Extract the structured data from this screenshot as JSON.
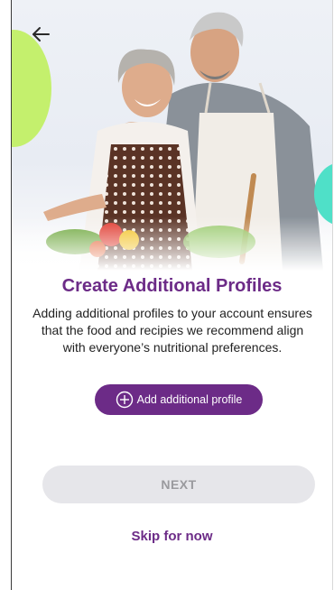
{
  "header": {
    "back_icon": "arrow-left-icon"
  },
  "hero": {
    "image_description": "",
    "accent_green": "#c4f06d",
    "accent_teal": "#4fe0c8"
  },
  "main": {
    "title": "Create Additional Profiles",
    "description": "Adding additional profiles to your account ensures that the food and recipies we recommend align with everyone’s nutritional preferences.",
    "add_profile_label": "Add additional profile",
    "add_icon": "plus-circle-icon",
    "next_label": "NEXT",
    "skip_label": "Skip for now"
  },
  "colors": {
    "brand": "#6c2b87",
    "next_bg": "#e6e6ea",
    "next_text": "#9a9a9e"
  }
}
